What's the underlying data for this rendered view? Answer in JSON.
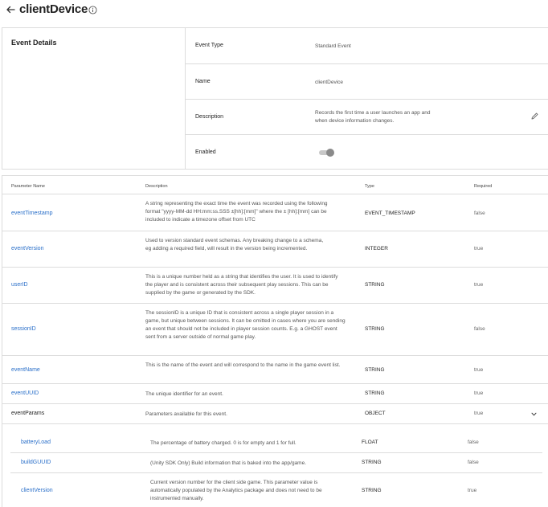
{
  "header": {
    "title": "clientDevice",
    "back_icon": "arrow-left-icon",
    "info_icon": "info-circle-icon"
  },
  "details": {
    "heading": "Event Details",
    "rows": [
      {
        "label": "Event Type",
        "value": "Standard Event"
      },
      {
        "label": "Name",
        "value": "clientDevice"
      },
      {
        "label": "Description",
        "value": "Records the first time a user launches an app and when device information changes."
      },
      {
        "label": "Enabled",
        "value": ""
      }
    ],
    "enabled": true,
    "edit_icon": "pencil-icon"
  },
  "params": {
    "columns": [
      "Parameter Name",
      "Description",
      "Type",
      "Required"
    ],
    "rows": [
      {
        "name": "eventTimestamp",
        "description": "A string representing the exact time the event was recorded using the following format \"yyyy-MM-dd HH:mm:ss.SSS ±[hh]:[mm]\" where the ± [hh]:[mm] can be included to indicate a timezone offset from UTC",
        "type": "EVENT_TIMESTAMP",
        "required": "false"
      },
      {
        "name": "eventVersion",
        "description": "Used to version standard event schemas. Any breaking change to a schema, eg adding a required field, will result in the version being incremented.",
        "type": "INTEGER",
        "required": "true"
      },
      {
        "name": "userID",
        "description": "This is a unique number held as a string that identifies the user. It is used to identify the player and is consistent across their subsequent play sessions. This can be supplied by the game or generated by the SDK.",
        "type": "STRING",
        "required": "true"
      },
      {
        "name": "sessionID",
        "description": "The sessionID is a unique ID that is consistent across a single player session in a game, but unique between sessions. It can be omitted in cases where you are sending an event that should not be included in player session counts. E.g. a GHOST event sent from a server outside of normal game play.",
        "type": "STRING",
        "required": "false"
      },
      {
        "name": "eventName",
        "description": "This is the name of the event and will correspond to the name in the game event list.",
        "type": "STRING",
        "required": "true"
      },
      {
        "name": "eventUUID",
        "description": "The unique identifier for an event.",
        "type": "STRING",
        "required": "true"
      },
      {
        "name": "eventParams",
        "description": "Parameters available for this event.",
        "type": "OBJECT",
        "required": "true"
      }
    ],
    "expand_icon": "chevron-down-icon",
    "nested": [
      {
        "name": "batteryLoad",
        "description": "The percentage of battery charged. 0 is for empty and 1 for full.",
        "type": "FLOAT",
        "required": "false"
      },
      {
        "name": "buildGUUID",
        "description": "(Unity SDK Only) Build information that is baked into the app/game.",
        "type": "STRING",
        "required": "false"
      },
      {
        "name": "clientVersion",
        "description": "Current version number for the client side game. This parameter value is automatically populated by the Analytics package and does not need to be instrumented manually.",
        "type": "STRING",
        "required": "true"
      }
    ]
  },
  "colors": {
    "link": "#2a6fc9",
    "border": "#dcdcdc",
    "text": "#1f1f1f"
  }
}
